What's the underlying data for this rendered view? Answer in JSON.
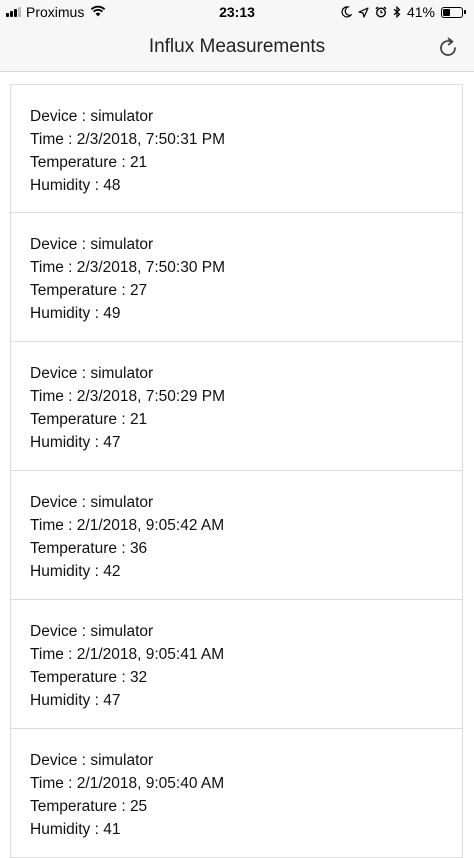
{
  "status_bar": {
    "carrier": "Proximus",
    "time": "23:13",
    "battery": "41%",
    "battery_level": 0.41
  },
  "nav": {
    "title": "Influx Measurements",
    "refresh_icon": "refresh-icon"
  },
  "labels": {
    "device": "Device : ",
    "time": "Time : ",
    "temperature": "Temperature : ",
    "humidity": "Humidity : "
  },
  "measurements": [
    {
      "device": "simulator",
      "time": "2/3/2018, 7:50:31 PM",
      "temperature": "21",
      "humidity": "48"
    },
    {
      "device": "simulator",
      "time": "2/3/2018, 7:50:30 PM",
      "temperature": "27",
      "humidity": "49"
    },
    {
      "device": "simulator",
      "time": "2/3/2018, 7:50:29 PM",
      "temperature": "21",
      "humidity": "47"
    },
    {
      "device": "simulator",
      "time": "2/1/2018, 9:05:42 AM",
      "temperature": "36",
      "humidity": "42"
    },
    {
      "device": "simulator",
      "time": "2/1/2018, 9:05:41 AM",
      "temperature": "32",
      "humidity": "47"
    },
    {
      "device": "simulator",
      "time": "2/1/2018, 9:05:40 AM",
      "temperature": "25",
      "humidity": "41"
    }
  ]
}
